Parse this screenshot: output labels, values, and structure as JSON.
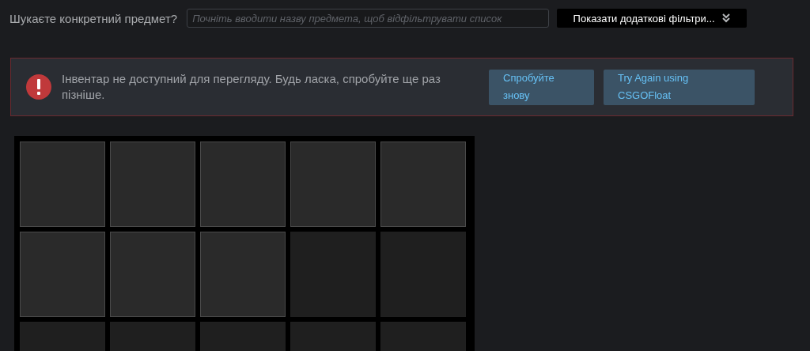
{
  "filter_bar": {
    "label": "Шукаєте конкретний предмет?",
    "search": {
      "placeholder": "Почніть вводити назву предмета, щоб відфільтрувати список"
    },
    "more_filters_button": {
      "label": "Показати додаткові фільтри..."
    }
  },
  "error": {
    "message": "Інвентар не доступний для перегляду. Будь ласка, спробуйте ще раз пізніше.",
    "buttons": [
      "Спробуйте знову",
      "Try Again using CSGOFloat"
    ]
  },
  "inventory_slots": [
    {
      "filled": true
    },
    {
      "filled": true
    },
    {
      "filled": true
    },
    {
      "filled": true
    },
    {
      "filled": true
    },
    {
      "filled": true
    },
    {
      "filled": true
    },
    {
      "filled": true
    },
    {
      "filled": false
    },
    {
      "filled": false
    },
    {
      "filled": false
    },
    {
      "filled": false
    },
    {
      "filled": false
    },
    {
      "filled": false
    },
    {
      "filled": false
    }
  ]
}
